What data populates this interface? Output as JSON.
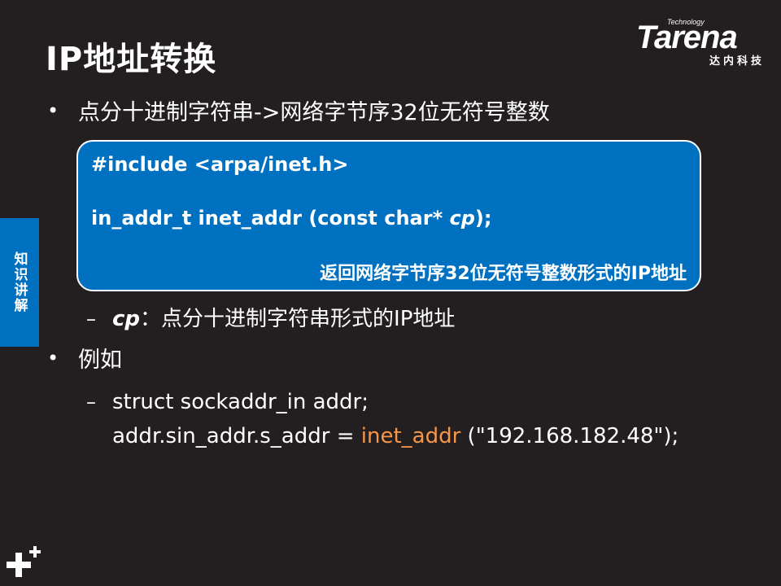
{
  "title": "IP地址转换",
  "logo": {
    "small_text": "Technology",
    "brand": "Tarena",
    "sub_text": "达内科技"
  },
  "side_tab": {
    "label": "知识讲解"
  },
  "bullet1": {
    "text": "点分十进制字符串->网络字节序32位无符号整数"
  },
  "code_box": {
    "line1": "#include <arpa/inet.h>",
    "line2_prefix": "in_addr_t inet_addr (const char* ",
    "line2_param": "cp",
    "line2_suffix": ");",
    "description": "返回网络字节序32位无符号整数形式的IP地址"
  },
  "param_desc": {
    "param": "cp",
    "text": "：点分十进制字符串形式的IP地址"
  },
  "bullet2": {
    "text": "例如"
  },
  "example": {
    "line1": "struct sockaddr_in addr;",
    "line2_prefix": "addr.sin_addr.s_addr = ",
    "line2_func": "inet_addr",
    "line2_suffix": " (\"192.168.182.48\");"
  },
  "colors": {
    "background": "#231f20",
    "accent_blue": "#0070c0",
    "highlight_orange": "#f79646"
  }
}
